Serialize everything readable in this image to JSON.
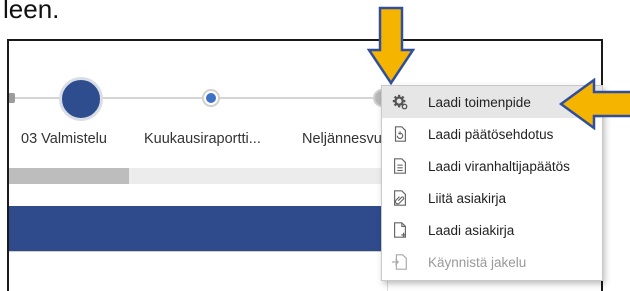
{
  "leading_text": "leen.",
  "timeline": {
    "steps": [
      {
        "label": "03 Valmistelu"
      },
      {
        "label": "Kuukausiraportti..."
      },
      {
        "label": "Neljännesvu"
      }
    ]
  },
  "context_menu": {
    "items": [
      {
        "label": "Laadi toimenpide",
        "icon": "gear-icon"
      },
      {
        "label": "Laadi päätösehdotus",
        "icon": "document-refresh-icon"
      },
      {
        "label": "Laadi viranhaltijapäätös",
        "icon": "document-lines-icon"
      },
      {
        "label": "Liitä asiakirja",
        "icon": "attach-document-icon"
      },
      {
        "label": "Laadi asiakirja",
        "icon": "new-document-icon"
      },
      {
        "label": "Käynnistä jakelu",
        "icon": "distribute-icon"
      }
    ]
  },
  "colors": {
    "primary_blue": "#2f4b8c",
    "arrow_fill": "#f5b400",
    "arrow_outline": "#2f4f9e"
  }
}
